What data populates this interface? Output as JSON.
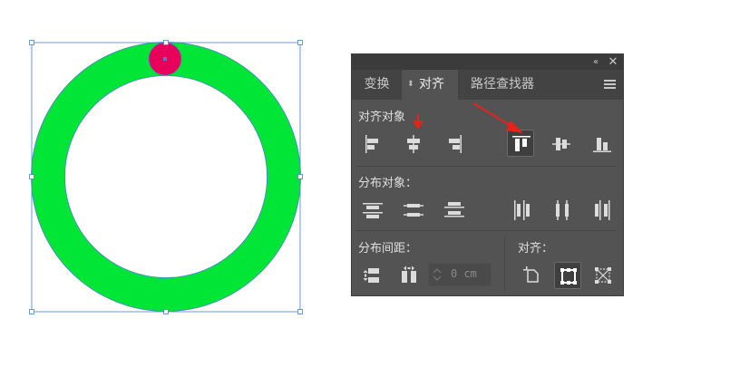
{
  "panel": {
    "collapse_icon": "double-chevron-left-icon",
    "close_icon": "close-icon",
    "tabs": [
      {
        "label": "变换",
        "active": false
      },
      {
        "label": "对齐",
        "active": true,
        "has_arrow": true
      },
      {
        "label": "路径查找器",
        "active": false
      }
    ],
    "menu_icon": "panel-menu-icon",
    "sections": {
      "align_objects": {
        "label": "对齐对象"
      },
      "distribute_objects": {
        "label": "分布对象："
      },
      "distribute_spacing": {
        "label": "分布间距：",
        "value": "0 cm"
      },
      "align_to": {
        "label": "对齐："
      }
    }
  },
  "colors": {
    "ring": "#00e536",
    "dot": "#e8005a",
    "selection": "#4a7fd4",
    "panel_bg": "#535353",
    "annotation": "#e8221a"
  }
}
